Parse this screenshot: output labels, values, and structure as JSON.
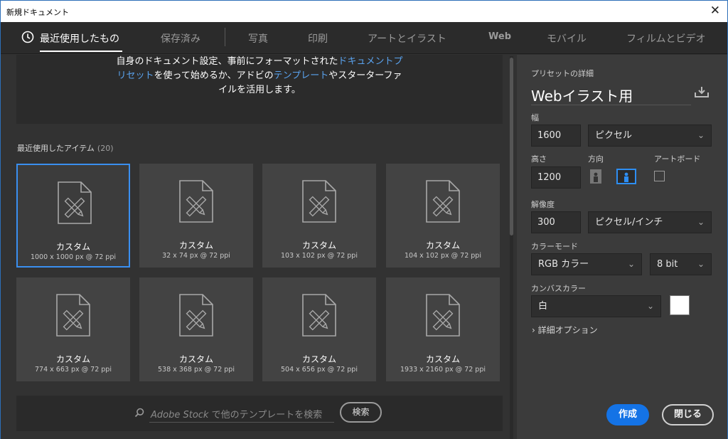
{
  "window": {
    "title": "新規ドキュメント",
    "close_glyph": "✕"
  },
  "tabs": [
    {
      "label": "最近使用したもの",
      "active": true
    },
    {
      "label": "保存済み"
    },
    {
      "label": "写真"
    },
    {
      "label": "印刷"
    },
    {
      "label": "アートとイラスト"
    },
    {
      "label": "Web"
    },
    {
      "label": "モバイル"
    },
    {
      "label": "フィルムとビデオ"
    }
  ],
  "welcome": {
    "l1a": "自身のドキュメント設定、事前にフォーマットされた",
    "l1b": "ドキュメントプ",
    "l2a": "リセット",
    "l2b": "を使って始めるか、アドビの",
    "l2c": "テンプレート",
    "l2d": "やスターターファ",
    "l3": "イルを活用します。"
  },
  "recent": {
    "label": "最近使用したアイテム",
    "count": "(20)",
    "items": [
      {
        "name": "カスタム",
        "dims": "1000 x 1000 px @ 72 ppi"
      },
      {
        "name": "カスタム",
        "dims": "32 x 74 px @ 72 ppi"
      },
      {
        "name": "カスタム",
        "dims": "103 x 102 px @ 72 ppi"
      },
      {
        "name": "カスタム",
        "dims": "104 x 102 px @ 72 ppi"
      },
      {
        "name": "カスタム",
        "dims": "774 x 663 px @ 72 ppi"
      },
      {
        "name": "カスタム",
        "dims": "538 x 368 px @ 72 ppi"
      },
      {
        "name": "カスタム",
        "dims": "504 x 656 px @ 72 ppi"
      },
      {
        "name": "カスタム",
        "dims": "1933 x 2160 px @ 72 ppi"
      }
    ]
  },
  "stock": {
    "brand": "Adobe Stock",
    "placeholder_rest": " で他のテンプレートを検索",
    "search_label": "検索"
  },
  "preset": {
    "section_label": "プリセットの詳細",
    "name": "Webイラスト用",
    "width_label": "幅",
    "width_value": "1600",
    "width_unit": "ピクセル",
    "height_label": "高さ",
    "height_value": "1200",
    "orientation_label": "方向",
    "artboard_label": "アートボード",
    "resolution_label": "解像度",
    "resolution_value": "300",
    "resolution_unit": "ピクセル/インチ",
    "color_mode_label": "カラーモード",
    "color_mode_value": "RGB カラー",
    "bit_depth_value": "8 bit",
    "canvas_color_label": "カンバスカラー",
    "canvas_color_value": "白",
    "advanced_label": "詳細オプション",
    "create_label": "作成",
    "close_label": "閉じる"
  },
  "colors": {
    "accent": "#1473e6",
    "link": "#5aa3ef",
    "selected_border": "#3a8ff0",
    "swatch": "#ffffff"
  }
}
